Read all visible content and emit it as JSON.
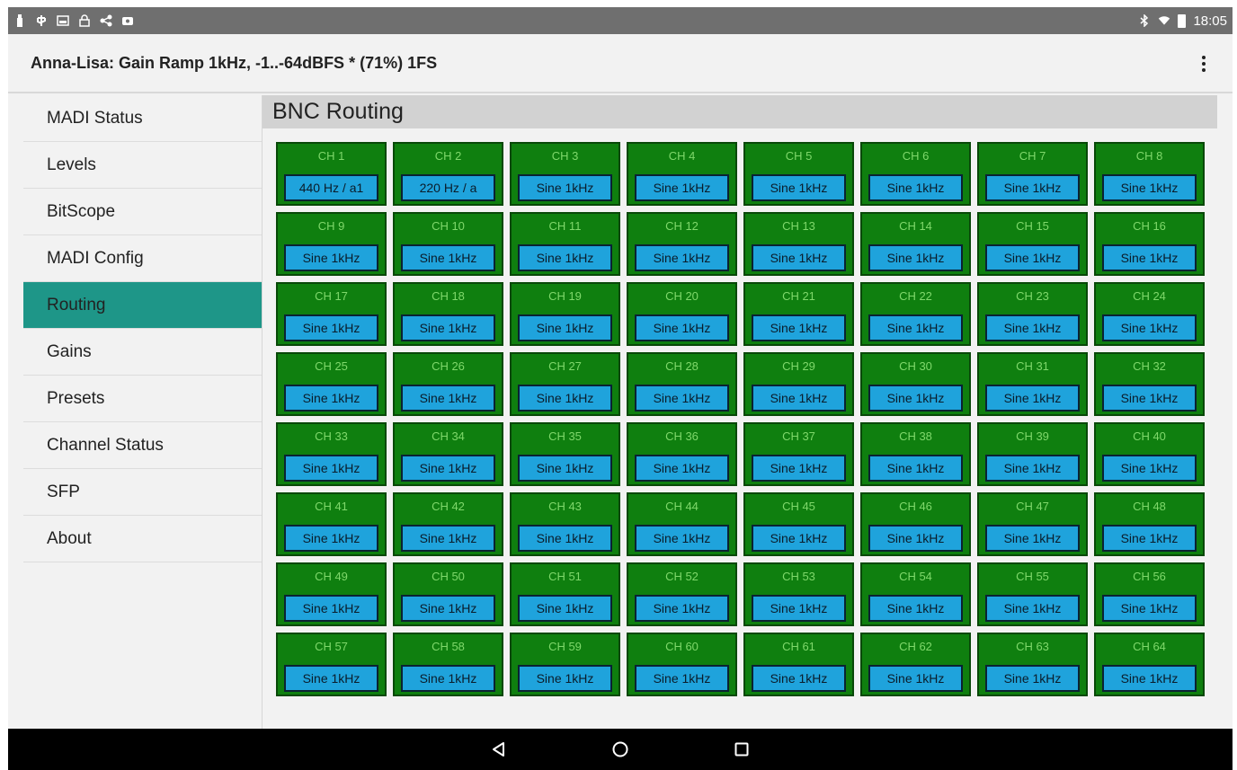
{
  "status_bar": {
    "time": "18:05",
    "left_icons": [
      "notification-icon",
      "usb-icon",
      "image-icon",
      "lock-icon",
      "share-icon",
      "gallery-icon"
    ],
    "right_icons": [
      "bluetooth-icon",
      "wifi-icon",
      "battery-icon"
    ]
  },
  "app_bar": {
    "title": "Anna-Lisa: Gain Ramp 1kHz, -1..-64dBFS * (71%) 1FS"
  },
  "sidebar": {
    "items": [
      {
        "label": "MADI Status",
        "active": false
      },
      {
        "label": "Levels",
        "active": false
      },
      {
        "label": "BitScope",
        "active": false
      },
      {
        "label": "MADI Config",
        "active": false
      },
      {
        "label": "Routing",
        "active": true
      },
      {
        "label": "Gains",
        "active": false
      },
      {
        "label": "Presets",
        "active": false
      },
      {
        "label": "Channel Status",
        "active": false
      },
      {
        "label": "SFP",
        "active": false
      },
      {
        "label": "About",
        "active": false
      }
    ]
  },
  "main": {
    "section_title": "BNC Routing",
    "channels": [
      {
        "name": "CH 1",
        "source": "440 Hz / a1"
      },
      {
        "name": "CH 2",
        "source": "220 Hz / a"
      },
      {
        "name": "CH 3",
        "source": "Sine 1kHz"
      },
      {
        "name": "CH 4",
        "source": "Sine 1kHz"
      },
      {
        "name": "CH 5",
        "source": "Sine 1kHz"
      },
      {
        "name": "CH 6",
        "source": "Sine 1kHz"
      },
      {
        "name": "CH 7",
        "source": "Sine 1kHz"
      },
      {
        "name": "CH 8",
        "source": "Sine 1kHz"
      },
      {
        "name": "CH 9",
        "source": "Sine 1kHz"
      },
      {
        "name": "CH 10",
        "source": "Sine 1kHz"
      },
      {
        "name": "CH 11",
        "source": "Sine 1kHz"
      },
      {
        "name": "CH 12",
        "source": "Sine 1kHz"
      },
      {
        "name": "CH 13",
        "source": "Sine 1kHz"
      },
      {
        "name": "CH 14",
        "source": "Sine 1kHz"
      },
      {
        "name": "CH 15",
        "source": "Sine 1kHz"
      },
      {
        "name": "CH 16",
        "source": "Sine 1kHz"
      },
      {
        "name": "CH 17",
        "source": "Sine 1kHz"
      },
      {
        "name": "CH 18",
        "source": "Sine 1kHz"
      },
      {
        "name": "CH 19",
        "source": "Sine 1kHz"
      },
      {
        "name": "CH 20",
        "source": "Sine 1kHz"
      },
      {
        "name": "CH 21",
        "source": "Sine 1kHz"
      },
      {
        "name": "CH 22",
        "source": "Sine 1kHz"
      },
      {
        "name": "CH 23",
        "source": "Sine 1kHz"
      },
      {
        "name": "CH 24",
        "source": "Sine 1kHz"
      },
      {
        "name": "CH 25",
        "source": "Sine 1kHz"
      },
      {
        "name": "CH 26",
        "source": "Sine 1kHz"
      },
      {
        "name": "CH 27",
        "source": "Sine 1kHz"
      },
      {
        "name": "CH 28",
        "source": "Sine 1kHz"
      },
      {
        "name": "CH 29",
        "source": "Sine 1kHz"
      },
      {
        "name": "CH 30",
        "source": "Sine 1kHz"
      },
      {
        "name": "CH 31",
        "source": "Sine 1kHz"
      },
      {
        "name": "CH 32",
        "source": "Sine 1kHz"
      },
      {
        "name": "CH 33",
        "source": "Sine 1kHz"
      },
      {
        "name": "CH 34",
        "source": "Sine 1kHz"
      },
      {
        "name": "CH 35",
        "source": "Sine 1kHz"
      },
      {
        "name": "CH 36",
        "source": "Sine 1kHz"
      },
      {
        "name": "CH 37",
        "source": "Sine 1kHz"
      },
      {
        "name": "CH 38",
        "source": "Sine 1kHz"
      },
      {
        "name": "CH 39",
        "source": "Sine 1kHz"
      },
      {
        "name": "CH 40",
        "source": "Sine 1kHz"
      },
      {
        "name": "CH 41",
        "source": "Sine 1kHz"
      },
      {
        "name": "CH 42",
        "source": "Sine 1kHz"
      },
      {
        "name": "CH 43",
        "source": "Sine 1kHz"
      },
      {
        "name": "CH 44",
        "source": "Sine 1kHz"
      },
      {
        "name": "CH 45",
        "source": "Sine 1kHz"
      },
      {
        "name": "CH 46",
        "source": "Sine 1kHz"
      },
      {
        "name": "CH 47",
        "source": "Sine 1kHz"
      },
      {
        "name": "CH 48",
        "source": "Sine 1kHz"
      },
      {
        "name": "CH 49",
        "source": "Sine 1kHz"
      },
      {
        "name": "CH 50",
        "source": "Sine 1kHz"
      },
      {
        "name": "CH 51",
        "source": "Sine 1kHz"
      },
      {
        "name": "CH 52",
        "source": "Sine 1kHz"
      },
      {
        "name": "CH 53",
        "source": "Sine 1kHz"
      },
      {
        "name": "CH 54",
        "source": "Sine 1kHz"
      },
      {
        "name": "CH 55",
        "source": "Sine 1kHz"
      },
      {
        "name": "CH 56",
        "source": "Sine 1kHz"
      },
      {
        "name": "CH 57",
        "source": "Sine 1kHz"
      },
      {
        "name": "CH 58",
        "source": "Sine 1kHz"
      },
      {
        "name": "CH 59",
        "source": "Sine 1kHz"
      },
      {
        "name": "CH 60",
        "source": "Sine 1kHz"
      },
      {
        "name": "CH 61",
        "source": "Sine 1kHz"
      },
      {
        "name": "CH 62",
        "source": "Sine 1kHz"
      },
      {
        "name": "CH 63",
        "source": "Sine 1kHz"
      },
      {
        "name": "CH 64",
        "source": "Sine 1kHz"
      }
    ]
  },
  "nav_bar": {
    "buttons": [
      "back-icon",
      "home-icon",
      "recents-icon"
    ]
  },
  "colors": {
    "accent": "#1e9688",
    "cell_green": "#0f7f0f",
    "cell_blue": "#1fa3dc"
  }
}
